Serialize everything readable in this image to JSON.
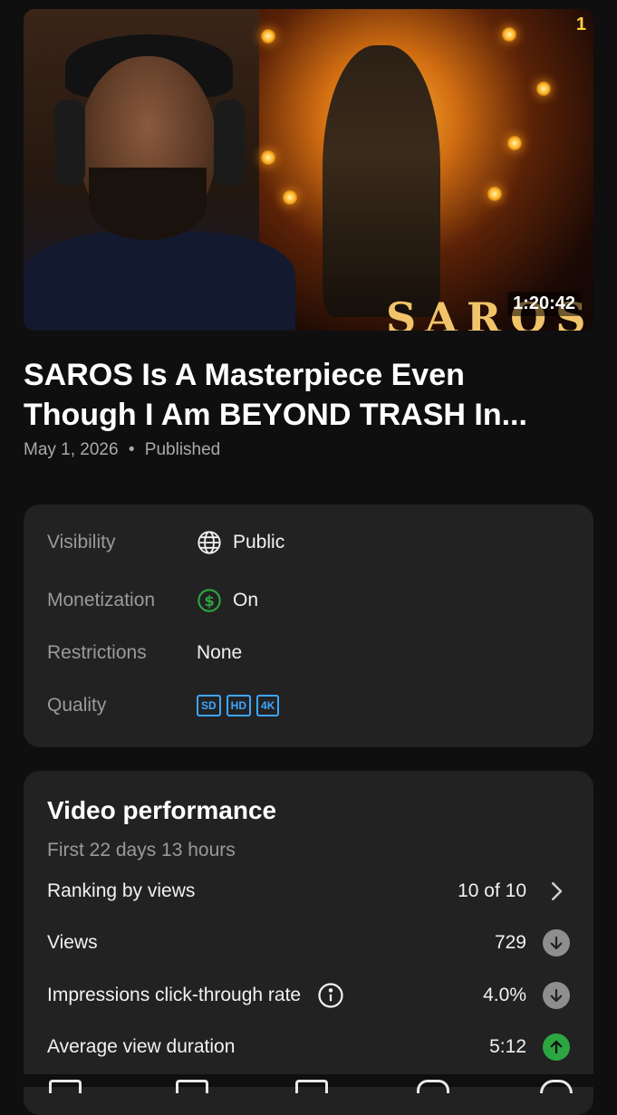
{
  "video": {
    "duration": "1:20:42",
    "thumbnail_logo_text": "SAROS",
    "thumbnail_corner_mark": "1",
    "title_line1": "SAROS Is A Masterpiece Even",
    "title_line2": "Though I Am BEYOND TRASH In...",
    "date": "May 1, 2026",
    "separator": "•",
    "status": "Published"
  },
  "details": {
    "visibility": {
      "label": "Visibility",
      "value": "Public",
      "icon": "globe-icon"
    },
    "monetization": {
      "label": "Monetization",
      "value": "On",
      "icon": "dollar-circle-icon",
      "icon_color": "#2ba640"
    },
    "restrictions": {
      "label": "Restrictions",
      "value": "None"
    },
    "quality": {
      "label": "Quality",
      "badges": [
        "SD",
        "HD",
        "4K"
      ],
      "badge_color": "#3ea6ff"
    }
  },
  "performance": {
    "title": "Video performance",
    "subtitle": "First 22 days 13 hours",
    "rows": [
      {
        "label": "Ranking by views",
        "value": "10 of 10",
        "indicator": "chevron-right-icon"
      },
      {
        "label": "Views",
        "value": "729",
        "indicator": "arrow-down-icon"
      },
      {
        "label": "Impressions click-through rate",
        "value": "4.0%",
        "indicator": "arrow-down-icon",
        "info": "info-icon"
      },
      {
        "label": "Average view duration",
        "value": "5:12",
        "indicator": "arrow-up-icon"
      }
    ]
  }
}
